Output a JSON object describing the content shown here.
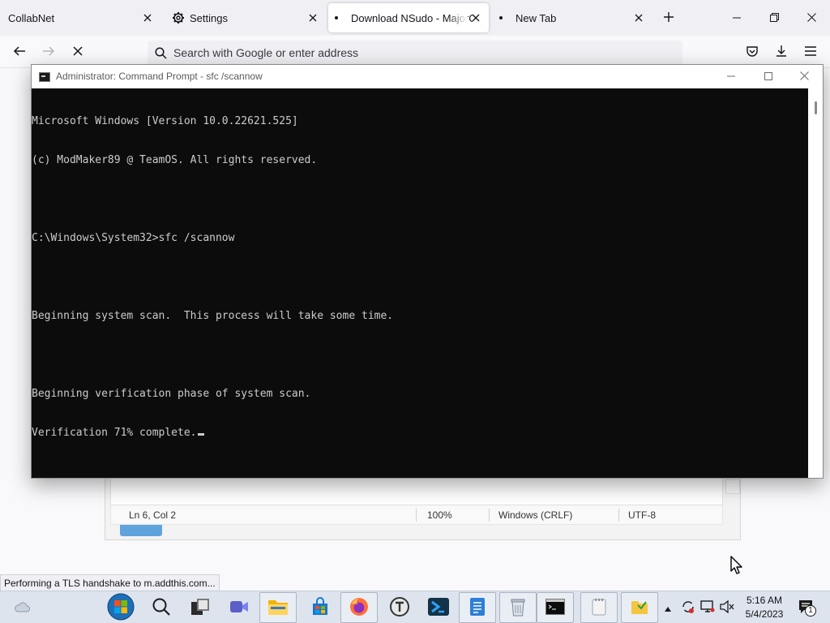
{
  "browser": {
    "tabs": [
      {
        "label": "CollabNet",
        "active": false
      },
      {
        "label": "Settings",
        "active": false,
        "icon": "gear-icon"
      },
      {
        "label": "Download NSudo - MajorGeeks",
        "active": true,
        "loading": true
      },
      {
        "label": "New Tab",
        "active": false,
        "loading": true
      }
    ],
    "new_tab_label": "+",
    "url_placeholder": "Search with Google or enter address",
    "status_text": "Performing a TLS handshake to m.addthis.com..."
  },
  "notepad": {
    "status": {
      "position": "Ln 6, Col 2",
      "zoom": "100%",
      "line_ending": "Windows (CRLF)",
      "encoding": "UTF-8"
    }
  },
  "cmd": {
    "title": "Administrator: Command Prompt - sfc  /scannow",
    "lines": [
      "Microsoft Windows [Version 10.0.22621.525]",
      "(c) ModMaker89 @ TeamOS. All rights reserved.",
      "",
      "C:\\Windows\\System32>sfc /scannow",
      "",
      "Beginning system scan.  This process will take some time.",
      "",
      "Beginning verification phase of system scan.",
      "Verification 71% complete."
    ],
    "text_color": "#cccccc",
    "background": "#0c0c0c"
  },
  "taskbar": {
    "items": [
      "start-button",
      "search-icon",
      "task-view-icon",
      "meet-icon",
      "file-explorer-icon",
      "store-icon",
      "firefox-icon",
      "app-t-icon",
      "powershell-icon",
      "notes-icon",
      "recycle-icon",
      "cmd-icon",
      "notepad-icon",
      "folder-icon"
    ],
    "clock": {
      "time": "5:16 AM",
      "date": "5/4/2023"
    },
    "notification_count": "1"
  }
}
